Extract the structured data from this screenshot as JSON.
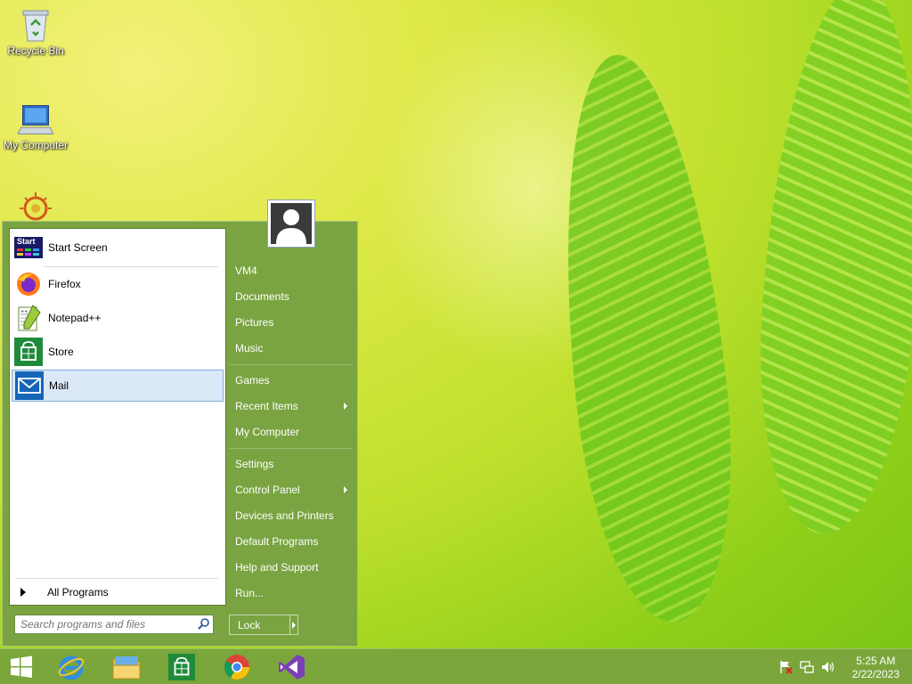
{
  "desktop": {
    "icons": [
      {
        "label": "Recycle Bin"
      },
      {
        "label": "My Computer"
      }
    ]
  },
  "start_menu": {
    "programs": [
      {
        "label": "Start Screen",
        "icon": "start-screen-icon"
      },
      {
        "label": "Firefox",
        "icon": "firefox-icon"
      },
      {
        "label": "Notepad++",
        "icon": "notepadpp-icon"
      },
      {
        "label": "Store",
        "icon": "store-icon"
      },
      {
        "label": "Mail",
        "icon": "mail-icon",
        "selected": true
      }
    ],
    "start_screen_badge": "Start",
    "all_programs": "All Programs",
    "search_placeholder": "Search programs and files",
    "right_items": [
      {
        "label": "VM4"
      },
      {
        "label": "Documents"
      },
      {
        "label": "Pictures"
      },
      {
        "label": "Music"
      },
      {
        "label": "Games"
      },
      {
        "label": "Recent Items",
        "submenu": true
      },
      {
        "label": "My Computer"
      },
      {
        "label": "Settings"
      },
      {
        "label": "Control Panel",
        "submenu": true
      },
      {
        "label": "Devices and Printers"
      },
      {
        "label": "Default Programs"
      },
      {
        "label": "Help and Support"
      },
      {
        "label": "Run..."
      }
    ],
    "lock_label": "Lock"
  },
  "taskbar": {
    "pinned": [
      "start-button",
      "internet-explorer-icon",
      "file-explorer-icon",
      "store-icon",
      "chrome-icon",
      "visual-studio-icon"
    ],
    "clock": {
      "time": "5:25 AM",
      "date": "2/22/2023"
    }
  },
  "colors": {
    "menu_green": "#79a441",
    "taskbar_green": "#7aa63c",
    "selection": "#dbe8f7"
  }
}
